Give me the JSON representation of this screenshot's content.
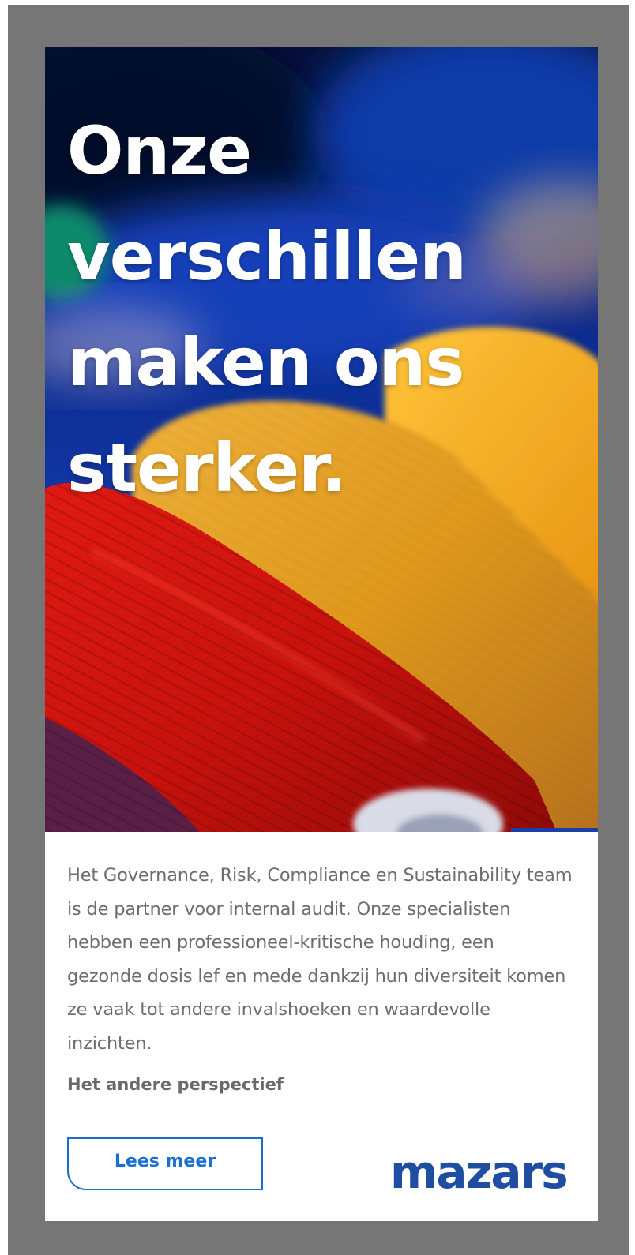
{
  "hero": {
    "headline_lines": [
      "Onze",
      "verschillen",
      "maken ons",
      "sterker."
    ],
    "image_subject": "colorful thread spools",
    "colors": {
      "deep_blue": "#0b2a8c",
      "red": "#d4150f",
      "orange": "#f0a018",
      "yellow": "#f2b21f",
      "purple": "#5a1f45"
    }
  },
  "content": {
    "body": "Het Governance, Risk, Compliance en Sustainability team is de partner voor internal audit. Onze specialisten hebben een professioneel-kritische houding, een gezonde dosis lef en mede dankzij hun diversiteit komen ze vaak tot andere invalshoeken en waardevolle inzichten.",
    "tagline": "Het andere perspectief",
    "cta_label": "Lees meer"
  },
  "brand": {
    "logo_text": "mazars",
    "logo_color": "#1f4ea0",
    "accent_color": "#1b6fd1"
  }
}
